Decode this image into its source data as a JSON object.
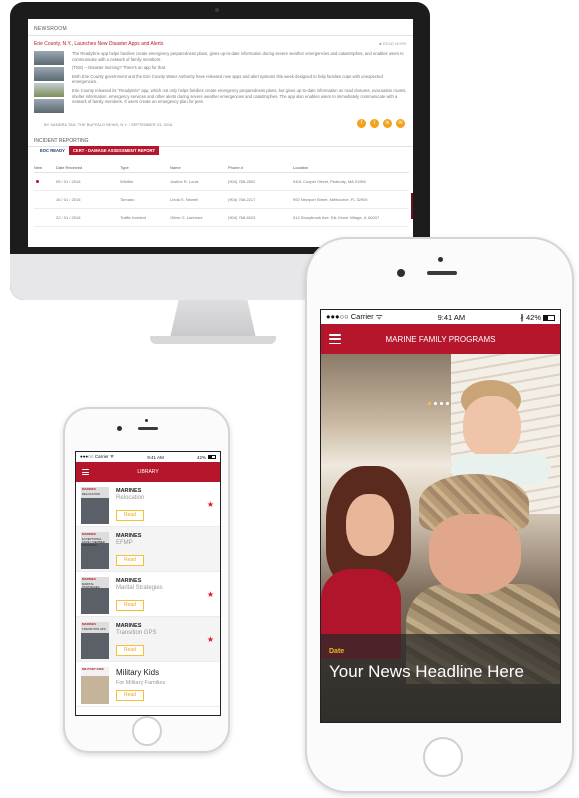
{
  "colors": {
    "accent_red": "#b5162b",
    "accent_gold": "#f2b51e",
    "star_red": "#e0172c"
  },
  "desktop": {
    "newsroom_header": "NEWSROOM",
    "article": {
      "title": "Erie County, N.Y., Launches New Disaster Apps and Alerts",
      "status": "■ READ MORE",
      "paragraphs": [
        "The ReadyErie app helps families create emergency preparedness plans, gives up-to-date information during severe weather emergencies and catastrophes, and enables users to communicate with a network of family members.",
        "(TNS) -- Disaster looming? There's an app for that.",
        "Both Erie County government and the Erie County Water Authority have released new apps and alert systems this week designed to help families cope with unexpected emergencies.",
        "Erie County released its \"ReadyErie\" app, which not only helps families create emergency preparedness plans, but gives up-to-date information on road closures, evacuation routes, shelter information, emergency services and other alerts during severe weather emergencies and catastrophes. The app also enables users to immediately communicate with a network of family members. If users create an emergency plan for pets."
      ],
      "byline": "BY SANDRA TAN, THE BUFFALO NEWS, N.Y. / SEPTEMBER 23, 2016",
      "social_icons": [
        "facebook-icon",
        "twitter-icon",
        "linkedin-icon",
        "email-icon"
      ]
    },
    "incident": {
      "header": "INCIDENT REPORTING",
      "tabs": [
        "EOC READY",
        "CERT - DAMAGE ASSESSMENT REPORT"
      ],
      "columns": [
        "New",
        "Date Received",
        "Type",
        "Name",
        "Phone #",
        "Location"
      ],
      "rows": [
        {
          "new": true,
          "date": "05 / 01 / 2016",
          "type": "Wildfire",
          "name": "Justine R. Louis",
          "phone": "(904) 768-2802",
          "location": "9401 Cooper Street, Peabody, MA 01960"
        },
        {
          "new": false,
          "date": "16 / 01 / 2016",
          "type": "Tornado",
          "name": "Linda S. Newell",
          "phone": "(904) 768-2217",
          "location": "992 Newport Street, Melbourne, FL 32904"
        },
        {
          "new": false,
          "date": "22 / 01 / 2016",
          "type": "Traffic Incident",
          "name": "Oliver G. Larimore",
          "phone": "(904) 768-6923",
          "location": "514 Stonybrook Ave. Elk Grove Village, IL 60007"
        }
      ]
    }
  },
  "small_phone": {
    "status": {
      "carrier": "●●●○○ Carrier",
      "wifi": "ᯤ",
      "time": "9:41 AM",
      "battery": "42%"
    },
    "title": "LIBRARY",
    "items": [
      {
        "cover_brand": "MARINES",
        "cover_sub": "RELOCATION",
        "title": "MARINES",
        "subtitle": "Relocation",
        "read": "Read",
        "starred": true
      },
      {
        "cover_brand": "MARINES",
        "cover_sub": "EXCEPTIONAL FAMILY MEMBER PROGRAM",
        "title": "MARINES",
        "subtitle": "EFMP",
        "read": "Read",
        "starred": false
      },
      {
        "cover_brand": "MARINES",
        "cover_sub": "MARITAL STRATEGIES",
        "title": "MARINES",
        "subtitle": "Marital Strategies",
        "read": "Read",
        "starred": true
      },
      {
        "cover_brand": "MARINES",
        "cover_sub": "TRANSITION GPS",
        "title": "MARINES",
        "subtitle": "Transition GPS",
        "read": "Read",
        "starred": true
      },
      {
        "cover_brand": "MILITARY KIDS",
        "cover_sub": "",
        "title": "Military Kids",
        "subtitle": "For Military Families",
        "read": "Read",
        "starred": false
      }
    ]
  },
  "big_phone": {
    "status": {
      "carrier": "●●●○○ Carrier",
      "wifi": "ᯤ",
      "time": "9:41 AM",
      "bluetooth": "∦",
      "battery": "42%"
    },
    "title": "MARINE FAMILY PROGRAMS",
    "carousel_dots": 4,
    "active_dot": 0,
    "caption": {
      "date": "Date",
      "headline": "Your News Headline Here"
    }
  }
}
